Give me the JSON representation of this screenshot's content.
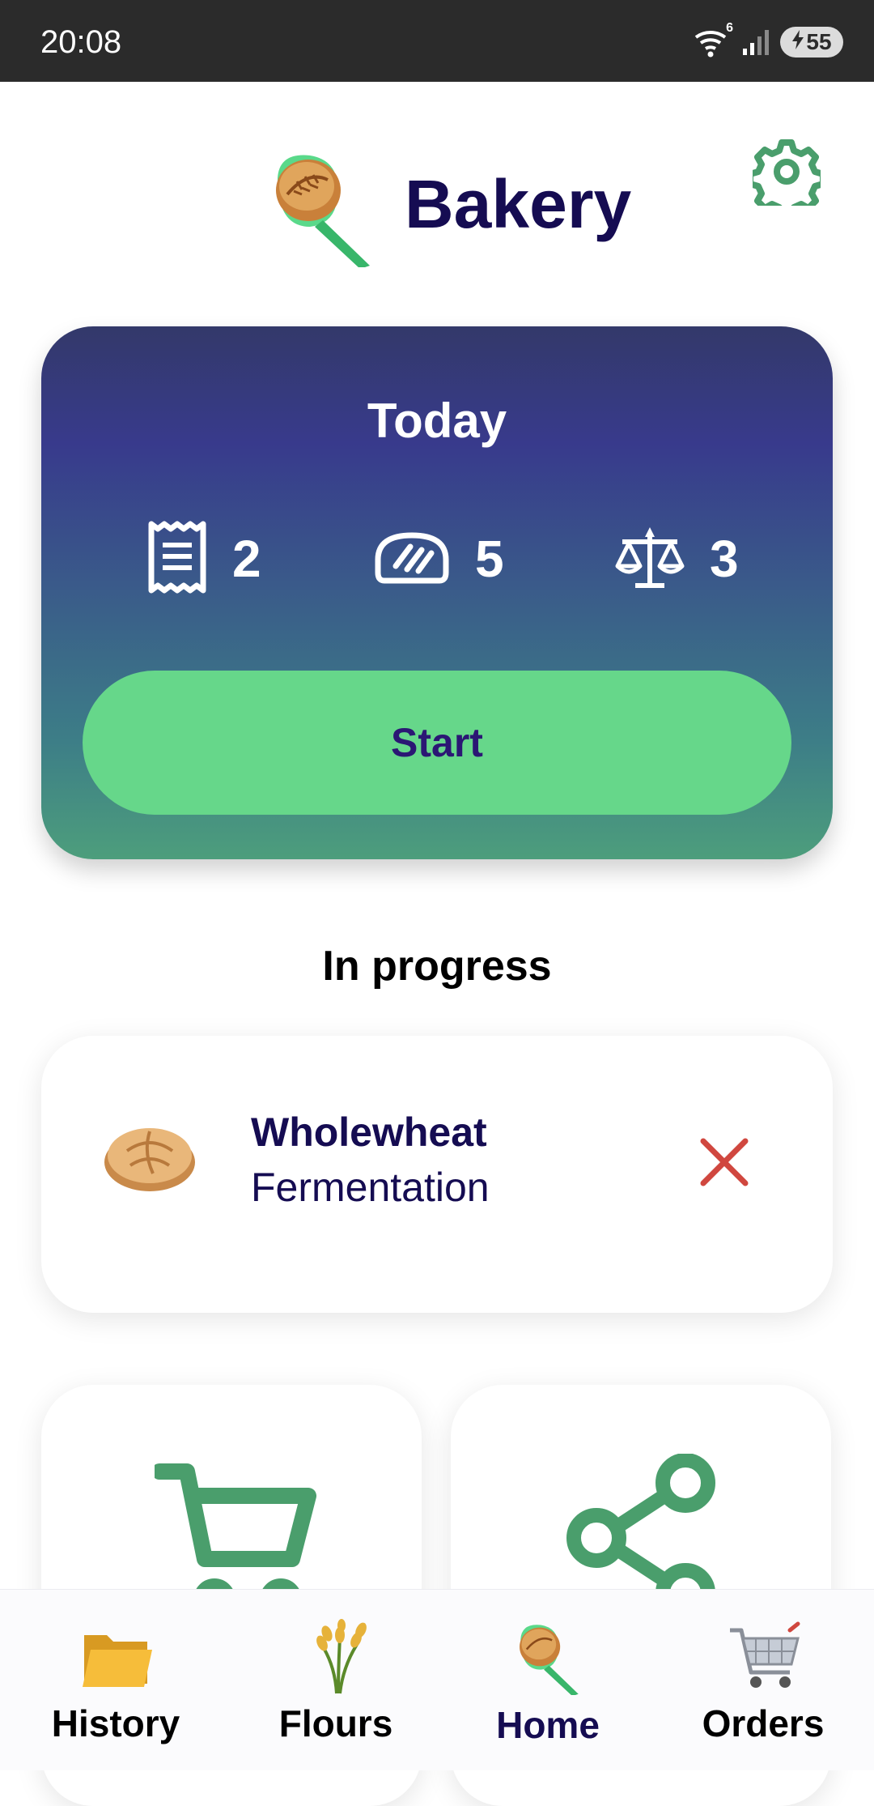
{
  "status_bar": {
    "time": "20:08",
    "wifi_badge": "6",
    "battery_level": "55",
    "icons": [
      "wifi-icon",
      "signal-icon",
      "battery-charging-icon"
    ]
  },
  "header": {
    "title": "Bakery",
    "logo_icon": "bread-peel-icon",
    "settings_icon": "gear-icon"
  },
  "today": {
    "title": "Today",
    "stats": [
      {
        "icon": "receipt-icon",
        "value": "2"
      },
      {
        "icon": "bread-loaf-icon",
        "value": "5"
      },
      {
        "icon": "scale-icon",
        "value": "3"
      }
    ],
    "start_label": "Start"
  },
  "in_progress": {
    "section_title": "In progress",
    "items": [
      {
        "name": "Wholewheat",
        "stage": "Fermentation",
        "icon": "round-bread-icon",
        "action_icon": "close-icon"
      }
    ]
  },
  "tiles": [
    {
      "icon": "cart-icon"
    },
    {
      "icon": "share-icon"
    }
  ],
  "bottom_nav": {
    "items": [
      {
        "label": "History",
        "icon": "folder-icon",
        "active": false
      },
      {
        "label": "Flours",
        "icon": "wheat-icon",
        "active": false
      },
      {
        "label": "Home",
        "icon": "bread-peel-icon",
        "active": true
      },
      {
        "label": "Orders",
        "icon": "cart-icon",
        "active": false
      }
    ]
  },
  "colors": {
    "primary_text": "#150c52",
    "accent_green": "#66d78a",
    "icon_green": "#4a9e6c",
    "danger": "#d0473f"
  }
}
